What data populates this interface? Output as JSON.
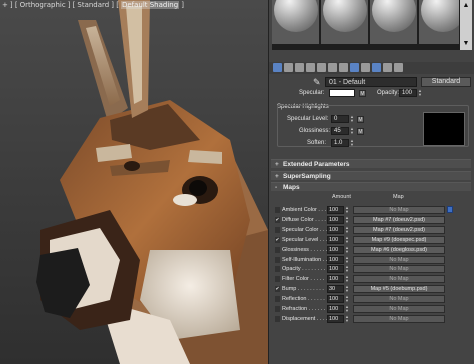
{
  "viewport": {
    "label_parts": [
      "+",
      "] [",
      "Orthographic",
      "] [",
      "Standard",
      "] [",
      "Default Shading",
      "]"
    ]
  },
  "material": {
    "name": "01 - Default",
    "type_button": "Standard"
  },
  "basic": {
    "specular_label": "Specular:",
    "specular_map_btn": "M",
    "opacity_label": "Opacity:",
    "opacity_value": "100"
  },
  "highlights": {
    "title": "Specular Highlights",
    "specular_level_label": "Specular Level:",
    "specular_level_value": "0",
    "glossiness_label": "Glossiness:",
    "glossiness_value": "45",
    "soften_label": "Soften:",
    "soften_value": "1.0",
    "map_btn": "M"
  },
  "rollouts": [
    {
      "symbol": "+",
      "title": "Extended Parameters"
    },
    {
      "symbol": "+",
      "title": "SuperSampling"
    },
    {
      "symbol": "-",
      "title": "Maps"
    }
  ],
  "maps": {
    "amount_header": "Amount",
    "map_header": "Map",
    "rows": [
      {
        "checked": false,
        "label": "Ambient Color . . . .",
        "amount": "100",
        "map": "No Map",
        "has_map": false,
        "lock": true
      },
      {
        "checked": true,
        "label": "Diffuse Color . . . .",
        "amount": "100",
        "map": "Map #7 (doeuv2.psd)",
        "has_map": true,
        "lock": false
      },
      {
        "checked": false,
        "label": "Specular Color . . .",
        "amount": "100",
        "map": "Map #7 (doeuv2.psd)",
        "has_map": true,
        "lock": false
      },
      {
        "checked": true,
        "label": "Specular Level . . .",
        "amount": "100",
        "map": "Map #9 (doespec.psd)",
        "has_map": true,
        "lock": false
      },
      {
        "checked": false,
        "label": "Glossiness . . . . . .",
        "amount": "100",
        "map": "Map #6 (doegloss.psd)",
        "has_map": true,
        "lock": false
      },
      {
        "checked": false,
        "label": "Self-Illumination . .",
        "amount": "100",
        "map": "No Map",
        "has_map": false,
        "lock": false
      },
      {
        "checked": false,
        "label": "Opacity . . . . . . . .",
        "amount": "100",
        "map": "No Map",
        "has_map": false,
        "lock": false
      },
      {
        "checked": false,
        "label": "Filter Color . . . . .",
        "amount": "100",
        "map": "No Map",
        "has_map": false,
        "lock": false
      },
      {
        "checked": true,
        "label": "Bump . . . . . . . . .",
        "amount": "30",
        "map": "Map #5 (doebump.psd)",
        "has_map": true,
        "lock": false
      },
      {
        "checked": false,
        "label": "Reflection . . . . . .",
        "amount": "100",
        "map": "No Map",
        "has_map": false,
        "lock": false
      },
      {
        "checked": false,
        "label": "Refraction . . . . . .",
        "amount": "100",
        "map": "No Map",
        "has_map": false,
        "lock": false
      },
      {
        "checked": false,
        "label": "Displacement . . . .",
        "amount": "100",
        "map": "No Map",
        "has_map": false,
        "lock": false
      }
    ]
  },
  "colors": {
    "panel_bg": "#444444",
    "accent_blue": "#3f6fc2"
  }
}
